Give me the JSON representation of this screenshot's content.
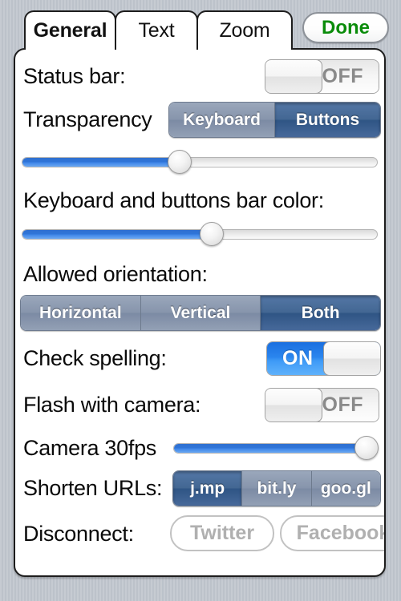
{
  "window": {
    "done_button": "Done"
  },
  "tabs": [
    {
      "label": "General",
      "active": true
    },
    {
      "label": "Text",
      "active": false
    },
    {
      "label": "Zoom",
      "active": false
    }
  ],
  "settings": {
    "status_bar": {
      "label": "Status bar:",
      "switch_state": "OFF"
    },
    "transparency": {
      "label": "Transparency",
      "options": [
        "Keyboard",
        "Buttons"
      ],
      "selected": "Buttons",
      "slider_value": 43
    },
    "bar_color": {
      "label": "Keyboard and buttons bar color:",
      "slider_value": 52
    },
    "allowed_orientation": {
      "label": "Allowed orientation:",
      "options": [
        "Horizontal",
        "Vertical",
        "Both"
      ],
      "selected": "Both"
    },
    "check_spelling": {
      "label": "Check spelling:",
      "switch_state": "ON"
    },
    "flash_with_camera": {
      "label": "Flash with camera:",
      "switch_state": "OFF"
    },
    "camera_fps": {
      "label": "Camera 30fps",
      "slider_value": 100
    },
    "shorten_urls": {
      "label": "Shorten URLs:",
      "options": [
        "j.mp",
        "bit.ly",
        "goo.gl"
      ],
      "selected": "j.mp"
    },
    "disconnect": {
      "label": "Disconnect:",
      "buttons": [
        "Twitter",
        "Facebook"
      ]
    }
  },
  "colors": {
    "accent_blue": "#2f74d8",
    "segment_selected": "#2f5585",
    "segment_normal": "#8795ac",
    "done_green": "#0a8c0a",
    "background": "#c3c8cf"
  }
}
